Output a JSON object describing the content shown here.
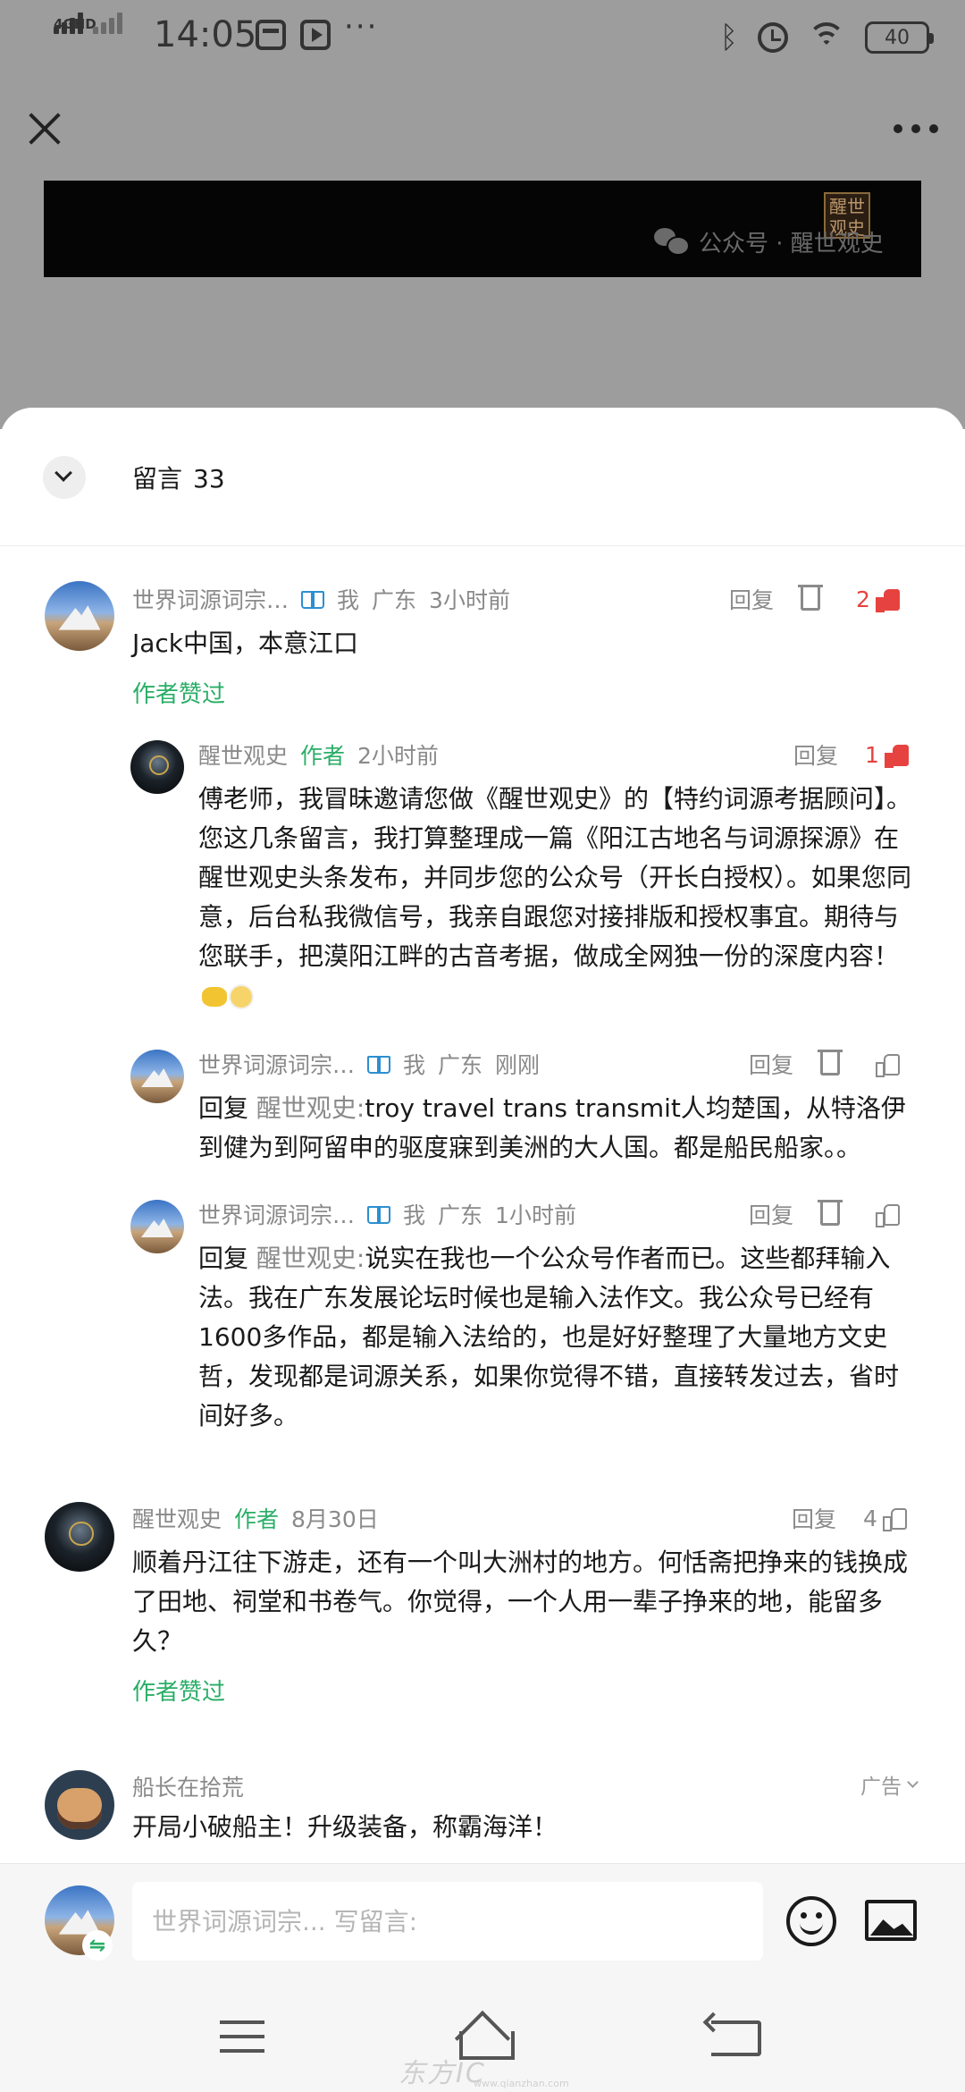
{
  "status_bar": {
    "network": "4GHD",
    "time": "14:05",
    "more": "···",
    "battery": "40"
  },
  "article": {
    "seal_text": "醒世观史",
    "watermark": "公众号 · 醒世观史"
  },
  "sheet": {
    "title": "留言",
    "count": "33"
  },
  "comments": [
    {
      "username": "世界词源词宗…",
      "me": "我",
      "location": "广东",
      "time": "3小时前",
      "reply_label": "回复",
      "likes": "2",
      "text": "Jack中国，本意江口",
      "author_liked": "作者赞过",
      "replies": [
        {
          "username": "醒世观史",
          "author_tag": "作者",
          "time": "2小时前",
          "reply_label": "回复",
          "likes": "1",
          "text": "傅老师，我冒昧邀请您做《醒世观史》的【特约词源考据顾问】。您这几条留言，我打算整理成一篇《阳江古地名与词源探源》在醒世观史头条发布，并同步您的公众号（开长白授权）。如果您同意，后台私我微信号，我亲自跟您对接排版和授权事宜。期待与您联手，把漠阳江畔的古音考据，做成全网独一份的深度内容！"
        },
        {
          "username": "世界词源词宗…",
          "me": "我",
          "location": "广东",
          "time": "刚刚",
          "reply_label": "回复",
          "reply_prefix": "回复",
          "reply_target": "醒世观史:",
          "text": "troy travel trans transmit人均楚国，从特洛伊到健为到阿留申的驱度寐到美洲的大人国。都是船民船家。。"
        },
        {
          "username": "世界词源词宗…",
          "me": "我",
          "location": "广东",
          "time": "1小时前",
          "reply_label": "回复",
          "reply_prefix": "回复",
          "reply_target": "醒世观史:",
          "text": "说实在我也一个公众号作者而已。这些都拜输入法。我在广东发展论坛时候也是输入法作文。我公众号已经有1600多作品，都是输入法给的，也是好好整理了大量地方文史哲，发现都是词源关系，如果你觉得不错，直接转发过去，省时间好多。"
        }
      ]
    },
    {
      "username": "醒世观史",
      "author_tag": "作者",
      "time": "8月30日",
      "reply_label": "回复",
      "likes": "4",
      "text": "顺着丹江往下游走，还有一个叫大洲村的地方。何恬斋把挣来的钱换成了田地、祠堂和书卷气。你觉得，一个人用一辈子挣来的地，能留多久？",
      "author_liked": "作者赞过"
    }
  ],
  "ad": {
    "username": "船长在拾荒",
    "label": "广告",
    "text": "开局小破船主！升级装备，称霸海洋！"
  },
  "composer": {
    "placeholder": "世界词源词宗... 写留言:",
    "switch_symbol": "⇋"
  },
  "watermark_site": {
    "text": "东方IC",
    "url": "www.qianzhan.com"
  },
  "colors": {
    "accent_green": "#2aae67",
    "like_red": "#e64340",
    "muted_gray": "#8a8a8a"
  }
}
